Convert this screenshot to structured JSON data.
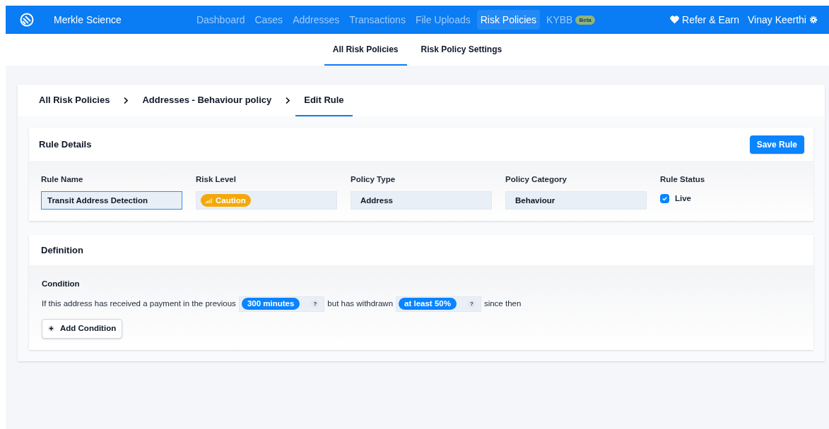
{
  "brand": {
    "name": "Merkle Science"
  },
  "nav": [
    {
      "label": "Dashboard",
      "selected": false
    },
    {
      "label": "Cases",
      "selected": false
    },
    {
      "label": "Addresses",
      "selected": false
    },
    {
      "label": "Transactions",
      "selected": false
    },
    {
      "label": "File Uploads",
      "selected": false
    },
    {
      "label": "Risk Policies",
      "selected": true
    },
    {
      "label": "KYBB",
      "selected": false,
      "badge": "Beta"
    }
  ],
  "refer": "Refer & Earn",
  "user": "Vinay Keerthi",
  "subtabs": [
    {
      "label": "All Risk Policies",
      "selected": true
    },
    {
      "label": "Risk Policy Settings",
      "selected": false
    }
  ],
  "breadcrumb": [
    {
      "label": "All Risk Policies",
      "selected": false
    },
    {
      "label": "Addresses - Behaviour policy",
      "selected": false
    },
    {
      "label": "Edit Rule",
      "selected": true
    }
  ],
  "rule_details": {
    "title": "Rule Details",
    "save_button": "Save Rule",
    "fields": [
      {
        "kind": "input",
        "label": "Rule Name",
        "value": "Transit Address Detection",
        "focused": true
      },
      {
        "kind": "risk",
        "label": "Risk Level",
        "value": "Caution",
        "color": "#f5a80b"
      },
      {
        "kind": "readonly",
        "label": "Policy Type",
        "value": "Address"
      },
      {
        "kind": "readonly",
        "label": "Policy Category",
        "value": "Behaviour"
      },
      {
        "kind": "checkbox",
        "label": "Rule Status",
        "value": "Live",
        "checked": true
      }
    ]
  },
  "definition": {
    "title": "Definition",
    "condition_label": "Condition",
    "parts": [
      {
        "kind": "text",
        "text": "If this address has received a payment in the previous"
      },
      {
        "kind": "select",
        "value": "300 minutes",
        "help": "?"
      },
      {
        "kind": "text",
        "text": "but has withdrawn"
      },
      {
        "kind": "select",
        "value": "at least 50%",
        "help": "?"
      },
      {
        "kind": "text",
        "text": "since then"
      }
    ],
    "add_button": "Add Condition"
  }
}
